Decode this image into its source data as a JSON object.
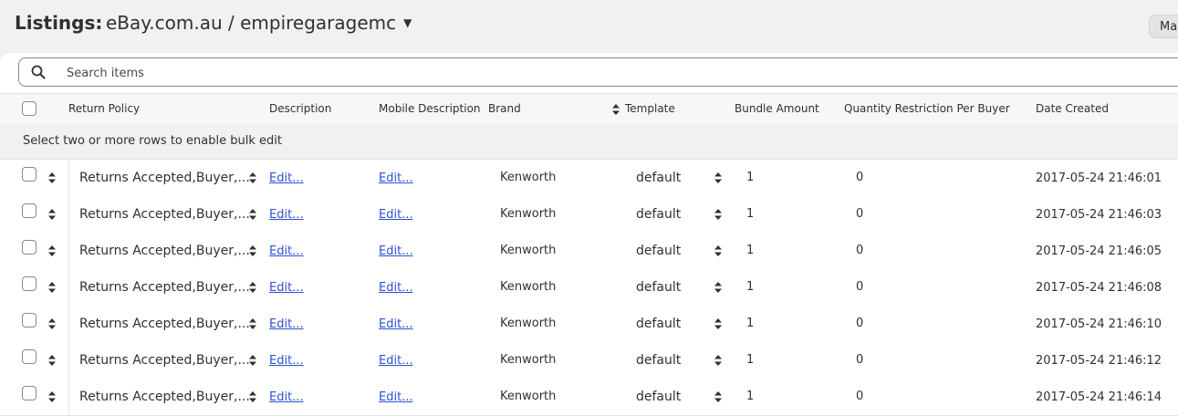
{
  "header": {
    "title": "Listings:",
    "store": "eBay.com.au / empiregaragemc",
    "corner_button": "Ma"
  },
  "search": {
    "placeholder": "Search items"
  },
  "columns": {
    "return_policy": "Return Policy",
    "description": "Description",
    "mobile_description": "Mobile Description",
    "brand": "Brand",
    "template": "Template",
    "bundle_amount": "Bundle Amount",
    "quantity_restriction": "Quantity Restriction Per Buyer",
    "date_created": "Date Created"
  },
  "bulk_edit_hint": "Select two or more rows to enable bulk edit",
  "rows": [
    {
      "return_policy": "Returns Accepted,Buyer,...",
      "description": "Edit...",
      "mobile_description": "Edit...",
      "brand": "Kenworth",
      "template": "default",
      "bundle_amount": "1",
      "quantity_restriction": "0",
      "date_created": "2017-05-24 21:46:01"
    },
    {
      "return_policy": "Returns Accepted,Buyer,...",
      "description": "Edit...",
      "mobile_description": "Edit...",
      "brand": "Kenworth",
      "template": "default",
      "bundle_amount": "1",
      "quantity_restriction": "0",
      "date_created": "2017-05-24 21:46:03"
    },
    {
      "return_policy": "Returns Accepted,Buyer,...",
      "description": "Edit...",
      "mobile_description": "Edit...",
      "brand": "Kenworth",
      "template": "default",
      "bundle_amount": "1",
      "quantity_restriction": "0",
      "date_created": "2017-05-24 21:46:05"
    },
    {
      "return_policy": "Returns Accepted,Buyer,...",
      "description": "Edit...",
      "mobile_description": "Edit...",
      "brand": "Kenworth",
      "template": "default",
      "bundle_amount": "1",
      "quantity_restriction": "0",
      "date_created": "2017-05-24 21:46:08"
    },
    {
      "return_policy": "Returns Accepted,Buyer,...",
      "description": "Edit...",
      "mobile_description": "Edit...",
      "brand": "Kenworth",
      "template": "default",
      "bundle_amount": "1",
      "quantity_restriction": "0",
      "date_created": "2017-05-24 21:46:10"
    },
    {
      "return_policy": "Returns Accepted,Buyer,...",
      "description": "Edit...",
      "mobile_description": "Edit...",
      "brand": "Kenworth",
      "template": "default",
      "bundle_amount": "1",
      "quantity_restriction": "0",
      "date_created": "2017-05-24 21:46:12"
    },
    {
      "return_policy": "Returns Accepted,Buyer,...",
      "description": "Edit...",
      "mobile_description": "Edit...",
      "brand": "Kenworth",
      "template": "default",
      "bundle_amount": "1",
      "quantity_restriction": "0",
      "date_created": "2017-05-24 21:46:14"
    }
  ]
}
